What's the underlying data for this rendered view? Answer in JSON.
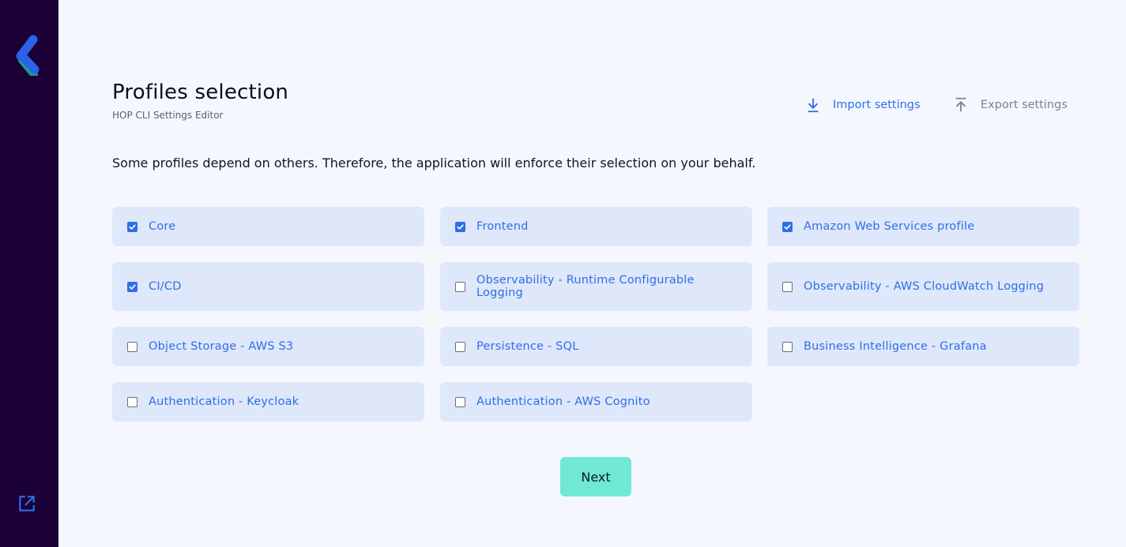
{
  "sidebar": {
    "logo_icon": "app-logo",
    "external_link_icon": "external-link-icon"
  },
  "header": {
    "title": "Profiles selection",
    "subtitle": "HOP CLI Settings Editor",
    "import_label": "Import settings",
    "export_label": "Export settings"
  },
  "intro_text": "Some profiles depend on others. Therefore, the application will enforce their selection on your behalf.",
  "profiles": [
    {
      "label": "Core",
      "checked": true
    },
    {
      "label": "Frontend",
      "checked": true
    },
    {
      "label": "Amazon Web Services profile",
      "checked": true
    },
    {
      "label": "CI/CD",
      "checked": true
    },
    {
      "label": "Observability - Runtime Configurable Logging",
      "checked": false
    },
    {
      "label": "Observability - AWS CloudWatch Logging",
      "checked": false
    },
    {
      "label": "Object Storage - AWS S3",
      "checked": false
    },
    {
      "label": "Persistence - SQL",
      "checked": false
    },
    {
      "label": "Business Intelligence - Grafana",
      "checked": false
    },
    {
      "label": "Authentication - Keycloak",
      "checked": false
    },
    {
      "label": "Authentication - AWS Cognito",
      "checked": false
    }
  ],
  "next_label": "Next",
  "colors": {
    "sidebar": "#1c0038",
    "background": "#f4f7fe",
    "accent": "#2d6fe6",
    "card": "#dfe7fb",
    "next_button": "#6fe8d5"
  }
}
